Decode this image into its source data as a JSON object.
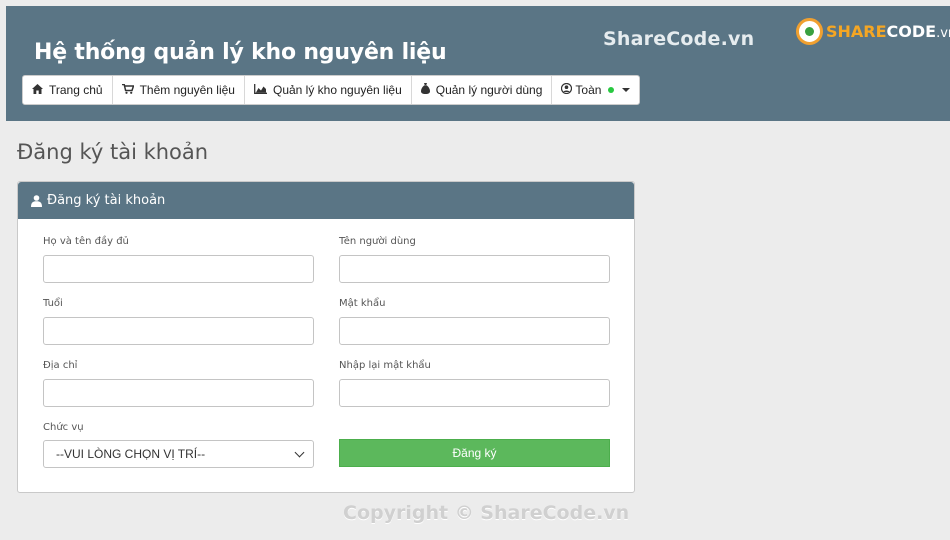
{
  "app": {
    "title": "Hệ thống quản lý kho nguyên liệu"
  },
  "nav": {
    "items": [
      {
        "icon": "home-icon",
        "label": "Trang chủ"
      },
      {
        "icon": "cart-icon",
        "label": "Thêm nguyên liệu"
      },
      {
        "icon": "chart-icon",
        "label": "Quản lý kho nguyên liệu"
      },
      {
        "icon": "money-bag-icon",
        "label": "Quản lý người dùng"
      },
      {
        "icon": "user-circle-icon",
        "label": "Toàn",
        "status_color": "#28c840"
      }
    ]
  },
  "watermark": {
    "text": "ShareCode.vn",
    "logo_main": "SHARE",
    "logo_code": "CODE",
    "logo_suffix": ".vn"
  },
  "page": {
    "heading": "Đăng ký tài khoản"
  },
  "form": {
    "panel_title": "Đăng ký tài khoản",
    "fields": {
      "fullname": {
        "label": "Họ và tên đầy đủ",
        "value": ""
      },
      "username": {
        "label": "Tên người dùng",
        "value": ""
      },
      "age": {
        "label": "Tuổi",
        "value": ""
      },
      "password": {
        "label": "Mật khẩu",
        "value": ""
      },
      "address": {
        "label": "Địa chỉ",
        "value": ""
      },
      "confirm_password": {
        "label": "Nhập lại mật khẩu",
        "value": ""
      },
      "position": {
        "label": "Chức vụ",
        "selected": "--VUI LÒNG CHỌN VỊ TRÍ--"
      }
    },
    "submit_label": "Đăng ký"
  },
  "footer": {
    "copyright": "Copyright © ShareCode.vn"
  },
  "colors": {
    "header_bg": "#5a7585",
    "page_bg": "#ececec",
    "submit_bg": "#5cb85c",
    "status_online": "#28c840"
  }
}
